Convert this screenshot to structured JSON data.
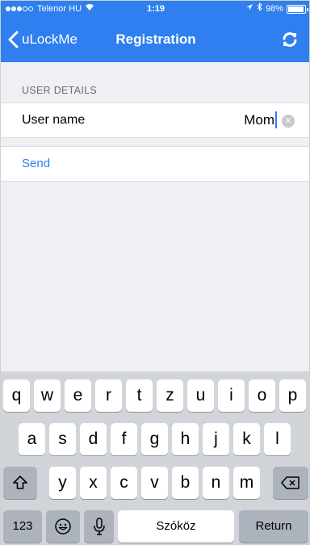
{
  "status_bar": {
    "carrier": "Telenor HU",
    "time": "1:19",
    "battery": "98%",
    "icons": [
      "signal-dots-icon",
      "wifi-icon",
      "location-arrow-icon",
      "bluetooth-icon",
      "battery-icon"
    ]
  },
  "nav": {
    "back_label": "uLockMe",
    "title": "Registration",
    "refresh_icon": "refresh-icon"
  },
  "section": {
    "header": "USER DETAILS"
  },
  "form": {
    "username_label": "User name",
    "username_value": "Mom"
  },
  "actions": {
    "send_label": "Send"
  },
  "colors": {
    "accent": "#2f7ff0",
    "background": "#efeff4",
    "keyboard_bg": "#d1d4d9"
  },
  "keyboard": {
    "row1": [
      "q",
      "w",
      "e",
      "r",
      "t",
      "z",
      "u",
      "i",
      "o",
      "p"
    ],
    "row2": [
      "a",
      "s",
      "d",
      "f",
      "g",
      "h",
      "j",
      "k",
      "l"
    ],
    "row3": [
      "y",
      "x",
      "c",
      "v",
      "b",
      "n",
      "m"
    ],
    "numbers_label": "123",
    "space_label": "Szóköz",
    "return_label": "Return",
    "icons": [
      "shift-icon",
      "backspace-icon",
      "emoji-icon",
      "microphone-icon"
    ]
  }
}
